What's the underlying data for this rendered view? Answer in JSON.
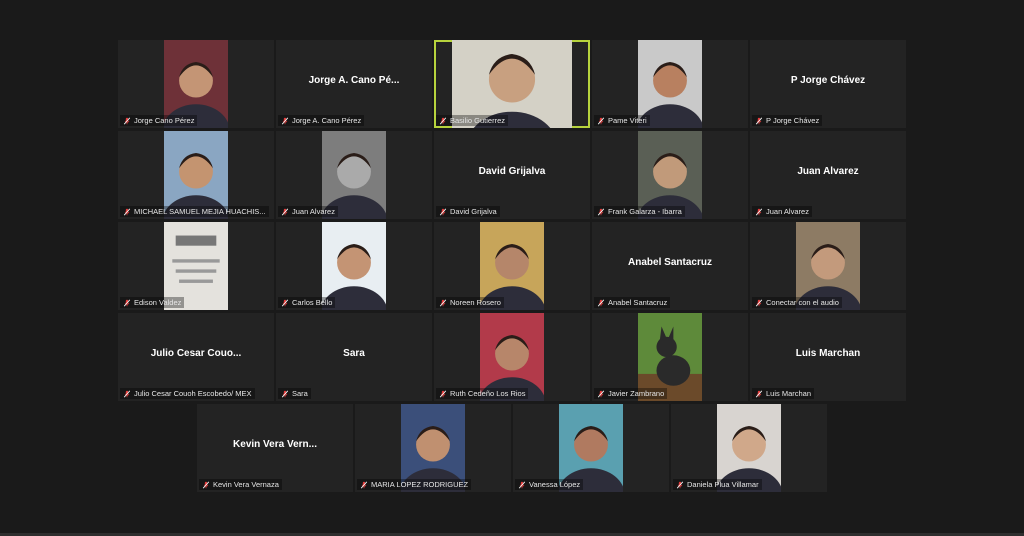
{
  "rows": [
    [
      {
        "display": "video",
        "name": "Jorge Cano Pérez",
        "icon": "person-photo-icon",
        "bg": "#6e3138",
        "skin": "#c49575"
      },
      {
        "display": "name",
        "name": "Jorge A. Cano Pérez",
        "big": "Jorge A. Cano Pé..."
      },
      {
        "display": "video",
        "name": "Basilio Gutierrez",
        "icon": "person-photo-icon",
        "bg": "#d4d1c6",
        "skin": "#c8a080",
        "active": true,
        "wide": true
      },
      {
        "display": "video",
        "name": "Pame Viteri",
        "icon": "person-photo-icon",
        "bg": "#c9c9c9",
        "skin": "#b88060"
      },
      {
        "display": "name",
        "name": "P Jorge Chávez",
        "big": "P Jorge Chávez"
      }
    ],
    [
      {
        "display": "video",
        "name": "MICHAEL SAMUEL MEJIA HUACHIS...",
        "icon": "person-photo-icon",
        "bg": "#8aa6c2",
        "skin": "#c49470"
      },
      {
        "display": "video",
        "name": "Juan Alvarez",
        "icon": "person-photo-icon",
        "bg": "#7d7d7d",
        "skin": "#aaaaaa"
      },
      {
        "display": "name",
        "name": "David Grijalva",
        "big": "David Grijalva"
      },
      {
        "display": "video",
        "name": "Frank Galarza - Ibarra",
        "icon": "person-photo-icon",
        "bg": "#5a5f55",
        "skin": "#c19a7a"
      },
      {
        "display": "name",
        "name": "Juan Alvarez",
        "big": "Juan Alvarez"
      }
    ],
    [
      {
        "display": "video",
        "name": "Edison Valdez",
        "icon": "document-photo-icon",
        "bg": "#e4e2dd",
        "skin": "#9a9a9a"
      },
      {
        "display": "video",
        "name": "Carlos Bello",
        "icon": "person-photo-icon",
        "bg": "#e8eef2",
        "skin": "#c49474"
      },
      {
        "display": "video",
        "name": "Noreen Rosero",
        "icon": "person-photo-icon",
        "bg": "#c7a55a",
        "skin": "#b5866a"
      },
      {
        "display": "name",
        "name": "Anabel Santacruz",
        "big": "Anabel Santacruz"
      },
      {
        "display": "video",
        "name": "Conectar con el audio",
        "icon": "person-photo-icon",
        "bg": "#8d7b64",
        "skin": "#c39a7c"
      }
    ],
    [
      {
        "display": "name",
        "name": "Julio Cesar Couoh Escobedo/ MEX",
        "big": "Julio Cesar Couo..."
      },
      {
        "display": "name",
        "name": "Sara",
        "big": "Sara"
      },
      {
        "display": "video",
        "name": "Ruth Cedeño Los Rios",
        "icon": "person-photo-icon",
        "bg": "#b23a4a",
        "skin": "#b7866a"
      },
      {
        "display": "video",
        "name": "Javier Zambrano",
        "icon": "dog-photo-icon",
        "bg": "#5e8a3a",
        "skin": "#2a2a2a"
      },
      {
        "display": "name",
        "name": "Luis Marchan",
        "big": "Luis Marchan"
      }
    ],
    [
      {
        "display": "name",
        "name": "Kevin Vera Vernaza",
        "big": "Kevin Vera Vern..."
      },
      {
        "display": "video",
        "name": "MARIA LOPEZ RODRIGUEZ",
        "icon": "person-photo-icon",
        "bg": "#3b4f7a",
        "skin": "#c09070"
      },
      {
        "display": "video",
        "name": "Vanessa López",
        "icon": "person-photo-icon",
        "bg": "#5aa0b0",
        "skin": "#b07a60"
      },
      {
        "display": "video",
        "name": "Daniela Plua Villamar",
        "icon": "person-photo-icon",
        "bg": "#d8d4d0",
        "skin": "#d0a88a"
      }
    ]
  ]
}
